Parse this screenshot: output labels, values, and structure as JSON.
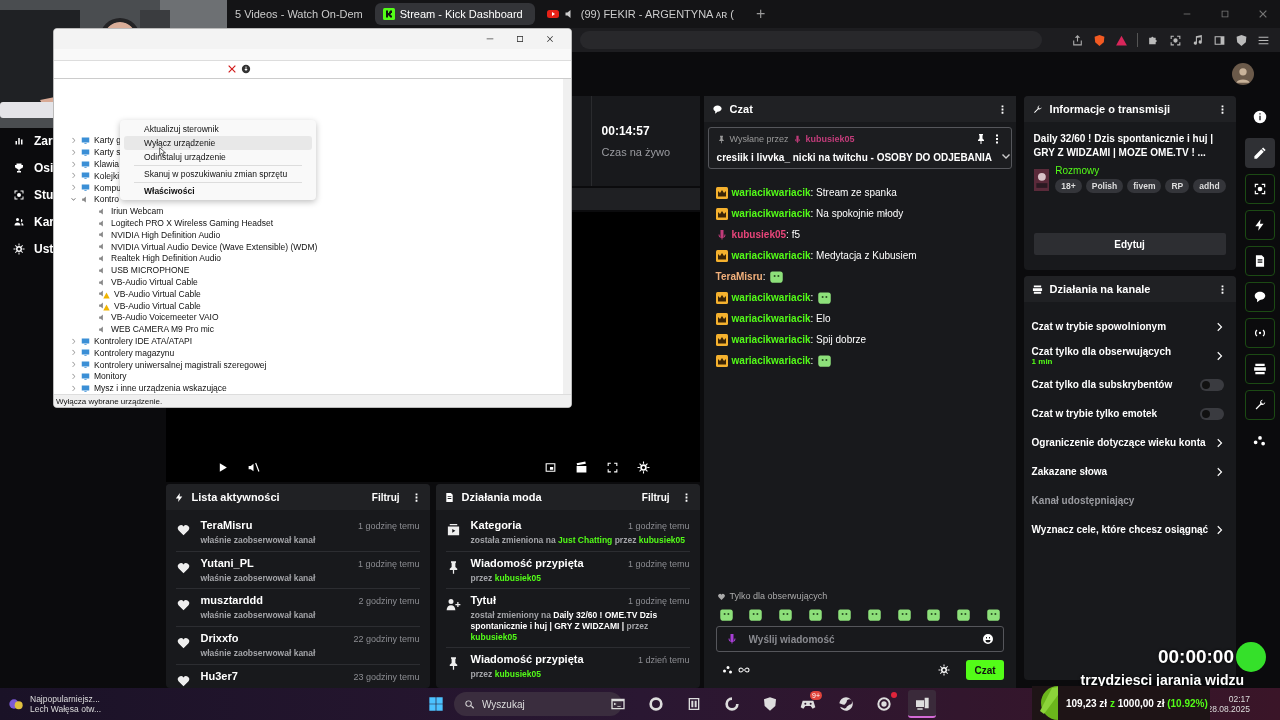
{
  "browser": {
    "tabs": [
      {
        "title": "5 Videos - Watch On-Dem",
        "selected": false,
        "kind": "page"
      },
      {
        "title": "Stream - Kick Dashboard",
        "selected": true,
        "kind": "kick"
      },
      {
        "title": "(99) FEKIR - ARGENTYNA ᴀʀ (",
        "selected": false,
        "kind": "youtube"
      }
    ],
    "new_tab": "+"
  },
  "sidebar": {
    "items": [
      {
        "label": "Zar",
        "kind": "chart"
      },
      {
        "label": "Osi",
        "kind": "trophy"
      },
      {
        "label": "Stu",
        "kind": "capture"
      },
      {
        "label": "Kar",
        "kind": "people"
      },
      {
        "label": "Ust",
        "kind": "gear"
      }
    ]
  },
  "stream_stat": {
    "value": "00:14:57",
    "label": "Czas na żywo"
  },
  "activity": {
    "title": "Lista aktywności",
    "filter": "Filtruj",
    "items": [
      {
        "name": "TeraMisru",
        "time": "1 godzinę temu",
        "detail": "właśnie zaobserwował kanał"
      },
      {
        "name": "Yutani_PL",
        "time": "1 godzinę temu",
        "detail": "właśnie zaobserwował kanał"
      },
      {
        "name": "musztarddd",
        "time": "2 godziny temu",
        "detail": "właśnie zaobserwował kanał"
      },
      {
        "name": "Drixxfo",
        "time": "22 godziny temu",
        "detail": "właśnie zaobserwował kanał"
      },
      {
        "name": "Hu3er7",
        "time": "23 godziny temu"
      }
    ]
  },
  "mod_actions": {
    "title": "Działania moda",
    "filter": "Filtruj",
    "items": [
      {
        "kind": "category",
        "title": "Kategoria",
        "time": "1 godzinę temu",
        "detail": [
          {
            "text": "została zmieniona na ",
            "kind": "plain"
          },
          {
            "text": "Just Chatting",
            "kind": "link"
          },
          {
            "text": " przez ",
            "kind": "plain"
          },
          {
            "text": "kubusiek05",
            "kind": "link"
          }
        ]
      },
      {
        "kind": "pin",
        "title": "Wiadomość przypięta",
        "time": "1 godzinę temu",
        "detail": [
          {
            "text": "przez ",
            "kind": "plain"
          },
          {
            "text": "kubusiek05",
            "kind": "link"
          }
        ]
      },
      {
        "kind": "person",
        "title": "Tytuł",
        "time": "1 godzinę temu",
        "detail": [
          {
            "text": "został zmieniony na ",
            "kind": "plain"
          },
          {
            "text": "Daily 32/60 ! OME.TV Dzis spontanicznie i huj | GRY Z WIDZAMI |",
            "kind": "bold"
          },
          {
            "text": " przez ",
            "kind": "plain"
          },
          {
            "text": "kubusiek05",
            "kind": "link"
          }
        ]
      },
      {
        "kind": "pin",
        "title": "Wiadomość przypięta",
        "time": "1 dzień temu",
        "detail": [
          {
            "text": "przez ",
            "kind": "plain"
          },
          {
            "text": "kubusiek05",
            "kind": "link"
          }
        ]
      }
    ]
  },
  "chat": {
    "title": "Czat",
    "pinned": {
      "label": "Wysłane przez",
      "author": "kubusiek05",
      "text": "cresiik i livvka_ nicki na twitchu - OSOBY DO ODJEBANIA"
    },
    "messages": [
      {
        "kind": "crown",
        "user": "wariacikwariacik",
        "color": "#53fc18",
        "text": ": Stream ze spanka",
        "emote": false
      },
      {
        "kind": "crown",
        "user": "wariacikwariacik",
        "color": "#53fc18",
        "text": ": Na spokojnie młody",
        "emote": false
      },
      {
        "kind": "mic",
        "user": "kubusiek05",
        "color": "#e9457a",
        "text": ": f5",
        "emote": false
      },
      {
        "kind": "crown",
        "user": "wariacikwariacik",
        "color": "#53fc18",
        "text": ": Medytacja z Kubusiem",
        "emote": false
      },
      {
        "kind": "plain",
        "user": "TeraMisru",
        "color": "#f2b07b",
        "text": ":",
        "emote": true
      },
      {
        "kind": "crown",
        "user": "wariacikwariacik",
        "color": "#53fc18",
        "text": ":",
        "emote": true
      },
      {
        "kind": "crown",
        "user": "wariacikwariacik",
        "color": "#53fc18",
        "text": ": Elo",
        "emote": false
      },
      {
        "kind": "crown",
        "user": "wariacikwariacik",
        "color": "#53fc18",
        "text": ": Spij dobrze",
        "emote": false
      },
      {
        "kind": "crown",
        "user": "wariacikwariacik",
        "color": "#53fc18",
        "text": ":",
        "emote": true
      }
    ],
    "followers_only": "Tylko dla obserwujących",
    "placeholder": "Wyślij wiadomość",
    "send": "Czat"
  },
  "stream_info": {
    "title": "Informacje o transmisji",
    "stream_title": "Daily 32/60 ! Dzis spontanicznie i huj | GRY Z WIDZAMI | MOZE OME.TV ! ...",
    "category": "Rozmowy",
    "tags": [
      "18+",
      "Polish",
      "fivem",
      "RP",
      "adhd"
    ],
    "edit": "Edytuj"
  },
  "channel_actions": {
    "title": "Działania na kanale",
    "items": [
      {
        "kind": "link",
        "label": "Czat w trybie spowolnionym"
      },
      {
        "kind": "link",
        "label": "Czat tylko dla obserwujących",
        "detail": "1 min"
      },
      {
        "kind": "toggle",
        "label": "Czat tylko dla subskrybentów",
        "on": false
      },
      {
        "kind": "toggle",
        "label": "Czat w trybie tylko emotek",
        "on": false
      },
      {
        "kind": "link",
        "label": "Ograniczenie dotyczące wieku konta"
      },
      {
        "kind": "link",
        "label": "Zakazane słowa"
      },
      {
        "kind": "heading",
        "label": "Kanał udostępniający"
      },
      {
        "kind": "link",
        "label": "Wyznacz cele, które chcesz osiągnąć"
      }
    ]
  },
  "rail": {
    "items": [
      {
        "kind": "info",
        "selected": false
      },
      {
        "kind": "pencil",
        "selected": true
      },
      {
        "kind": "capture",
        "selected": false
      },
      {
        "kind": "bolt",
        "selected": false
      },
      {
        "kind": "doc",
        "selected": false
      },
      {
        "kind": "bubble",
        "selected": false
      },
      {
        "kind": "broadcast",
        "selected": false
      },
      {
        "kind": "layout",
        "selected": false
      },
      {
        "kind": "wrench",
        "selected": false
      },
      {
        "kind": "dots",
        "selected": false
      }
    ]
  },
  "device_manager": {
    "tree": [
      {
        "label": "Karty g",
        "expanded": false
      },
      {
        "label": "Karty s",
        "expanded": false
      },
      {
        "label": "Klawia",
        "expanded": false
      },
      {
        "label": "Kolejki",
        "expanded": false
      },
      {
        "label": "Kompu",
        "expanded": false
      },
      {
        "label": "Kontro",
        "expanded": true,
        "children": [
          {
            "label": "Iriun Webcam",
            "warning": false
          },
          {
            "label": "Logitech PRO X Wireless Gaming Headset",
            "warning": false
          },
          {
            "label": "NVIDIA High Definition Audio",
            "warning": false
          },
          {
            "label": "NVIDIA Virtual Audio Device (Wave Extensible) (WDM)",
            "warning": false
          },
          {
            "label": "Realtek High Definition Audio",
            "warning": false
          },
          {
            "label": "USB MICROPHONE",
            "warning": false
          },
          {
            "label": "VB-Audio Virtual Cable",
            "warning": false
          },
          {
            "label": "VB-Audio Virtual Cable",
            "warning": true
          },
          {
            "label": "VB-Audio Virtual Cable",
            "warning": true
          },
          {
            "label": "VB-Audio Voicemeeter VAIO",
            "warning": false
          },
          {
            "label": "WEB CAMERA M9 Pro mic",
            "warning": false
          }
        ]
      },
      {
        "label": "Kontrolery IDE ATA/ATAPI",
        "expanded": false
      },
      {
        "label": "Kontrolery magazynu",
        "expanded": false
      },
      {
        "label": "Kontrolery uniwersalnej magistrali szeregowej",
        "expanded": false
      },
      {
        "label": "Monitory",
        "expanded": false
      },
      {
        "label": "Mysz i inne urządzenia wskazujące",
        "expanded": false
      }
    ],
    "status": "Wyłącza wybrane urządzenie.",
    "context_menu": [
      {
        "kind": "item",
        "label": "Aktualizuj sterownik",
        "hovered": false,
        "default": false
      },
      {
        "kind": "item",
        "label": "Wyłącz urządzenie",
        "hovered": true,
        "default": false
      },
      {
        "kind": "item",
        "label": "Odinstaluj urządzenie",
        "hovered": false,
        "default": false
      },
      {
        "kind": "separator"
      },
      {
        "kind": "item",
        "label": "Skanuj w poszukiwaniu zmian sprzętu",
        "hovered": false,
        "default": false
      },
      {
        "kind": "separator"
      },
      {
        "kind": "item",
        "label": "Właściwości",
        "hovered": false,
        "default": true
      }
    ]
  },
  "overlay": {
    "timer": "00:00:00",
    "caption": "trzydziesci jarania widzu",
    "goal": [
      {
        "text": "109,23 zł ",
        "kind": "plain"
      },
      {
        "text": "z",
        "kind": "accent"
      },
      {
        "text": " 1000,00 zł ",
        "kind": "plain"
      },
      {
        "text": "(10.92%)",
        "kind": "accent"
      }
    ]
  },
  "taskbar": {
    "news": {
      "headline": "Najpopularniejsz...",
      "sub": "Lech Wałęsa otw..."
    },
    "placeholder": "Wyszukaj",
    "apps": [
      {
        "kind": "terminal",
        "active": false,
        "alert": false
      },
      {
        "kind": "ring",
        "active": false,
        "alert": false
      },
      {
        "kind": "notebook",
        "active": false,
        "alert": false
      },
      {
        "kind": "swirl",
        "active": false,
        "alert": false
      },
      {
        "kind": "shield",
        "active": false,
        "alert": false
      },
      {
        "kind": "gamepad",
        "active": false,
        "alert": false,
        "badge": "9+"
      },
      {
        "kind": "valve",
        "active": false,
        "alert": false
      },
      {
        "kind": "record",
        "active": false,
        "alert": true
      },
      {
        "kind": "computer",
        "active": true,
        "alert": false
      }
    ],
    "time": "02:17",
    "date": "28.08.2025"
  }
}
